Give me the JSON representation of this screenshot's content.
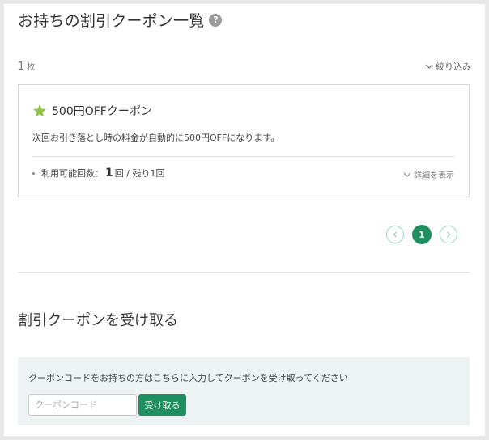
{
  "header": {
    "title": "お持ちの割引クーポン一覧",
    "help_glyph": "?"
  },
  "list": {
    "count": "1",
    "count_unit": "枚",
    "filter_label": "絞り込み"
  },
  "coupon": {
    "name": "500円OFFクーポン",
    "description": "次回お引き落とし時の料金が自動的に500円OFFになります。",
    "usage_label": "利用可能回数：",
    "usage_count": "1",
    "usage_suffix": "回 / 残り1回",
    "details_label": "詳細を表示",
    "star_color": "#8cc63f"
  },
  "pagination": {
    "current_page": "1"
  },
  "redeem": {
    "title": "割引クーポンを受け取る",
    "instruction": "クーポンコードをお持ちの方はこちらに入力してクーポンを受け取ってください",
    "input_placeholder": "クーポンコード",
    "submit_label": "受け取る"
  },
  "colors": {
    "accent": "#1f8f5f",
    "arrow_border": "#9fd4c0",
    "panel_bg": "#edf3f3"
  }
}
